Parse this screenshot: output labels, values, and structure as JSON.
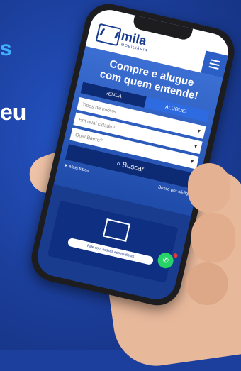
{
  "side_text": [
    "s",
    "eu"
  ],
  "app": {
    "logo_name": "mila",
    "logo_sub": "IMOBILIÁRIA"
  },
  "hero": {
    "headline_line1": "Compre e alugue",
    "headline_line2": "com quem entende!"
  },
  "tabs": [
    {
      "label": "VENDA"
    },
    {
      "label": "ALUGUEL"
    }
  ],
  "fields": [
    {
      "placeholder": "Tipos de imóvel"
    },
    {
      "placeholder": "Em qual cidade?"
    },
    {
      "placeholder": "Qual Bairro?"
    }
  ],
  "search_button": {
    "label": "Buscar"
  },
  "links": {
    "more_filters": "▼ Mais filtros",
    "search_code": "Busca por código"
  },
  "card": {
    "pill_text": "Fale com nossos especialistas"
  },
  "colors": {
    "brand": "#1a3c8f",
    "accent": "#2f6be0",
    "whatsapp": "#25d366"
  }
}
